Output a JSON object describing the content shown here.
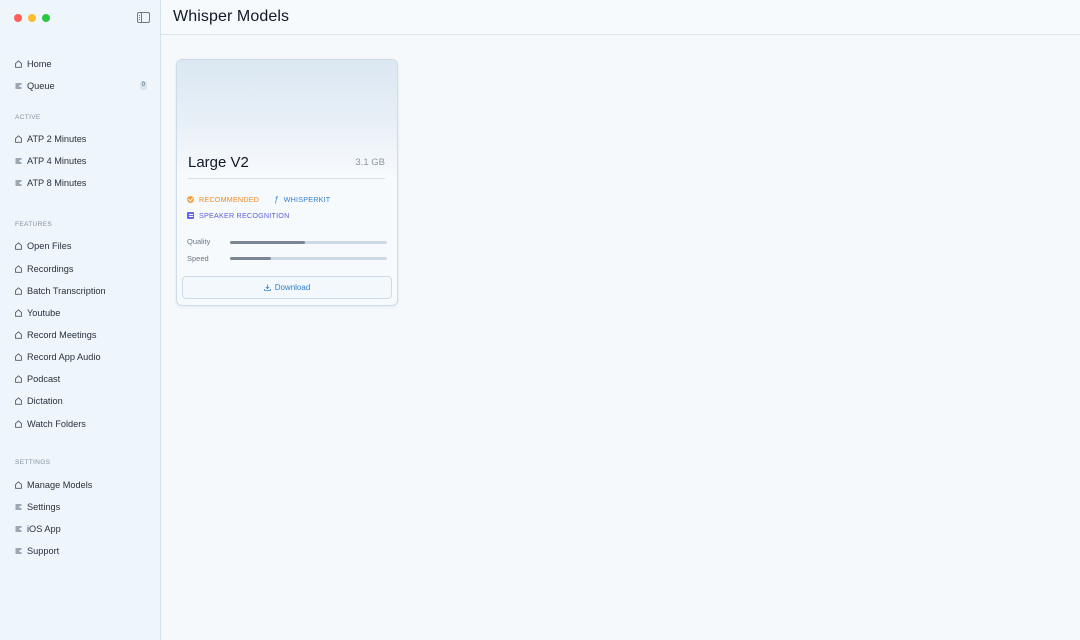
{
  "window": {
    "title": "Whisper Models"
  },
  "sidebar": {
    "top_items": [
      {
        "label": "Home",
        "icon": "home-icon"
      },
      {
        "label": "Queue",
        "icon": "list-icon",
        "badge": "0"
      }
    ],
    "sections": [
      {
        "label": "ACTIVE",
        "items": [
          {
            "label": "ATP 2 Minutes",
            "icon": "home-icon"
          },
          {
            "label": "ATP 4 Minutes",
            "icon": "list-icon"
          },
          {
            "label": "ATP 8 Minutes",
            "icon": "list-icon"
          }
        ]
      },
      {
        "label": "FEATURES",
        "items": [
          {
            "label": "Open Files",
            "icon": "home-icon"
          },
          {
            "label": "Recordings",
            "icon": "home-icon"
          },
          {
            "label": "Batch Transcription",
            "icon": "home-icon"
          },
          {
            "label": "Youtube",
            "icon": "home-icon"
          },
          {
            "label": "Record Meetings",
            "icon": "home-icon"
          },
          {
            "label": "Record App Audio",
            "icon": "home-icon"
          },
          {
            "label": "Podcast",
            "icon": "home-icon"
          },
          {
            "label": "Dictation",
            "icon": "home-icon"
          },
          {
            "label": "Watch Folders",
            "icon": "home-icon"
          }
        ]
      },
      {
        "label": "SETTINGS",
        "items": [
          {
            "label": "Manage Models",
            "icon": "home-icon"
          },
          {
            "label": "Settings",
            "icon": "list-icon"
          },
          {
            "label": "iOS App",
            "icon": "list-icon"
          },
          {
            "label": "Support",
            "icon": "list-icon"
          }
        ]
      }
    ]
  },
  "model_card": {
    "name": "Large V2",
    "size": "3.1 GB",
    "tags": {
      "recommended": "RECOMMENDED",
      "engine": "WHISPERKIT",
      "feature": "SPEAKER RECOGNITION"
    },
    "meters": {
      "quality": {
        "label": "Quality",
        "level": 0.48
      },
      "speed": {
        "label": "Speed",
        "level": 0.26
      }
    },
    "download_label": "Download"
  },
  "colors": {
    "accent": "#2f7fd3",
    "recommended": "#f08a24",
    "speaker": "#5b5fd6"
  }
}
